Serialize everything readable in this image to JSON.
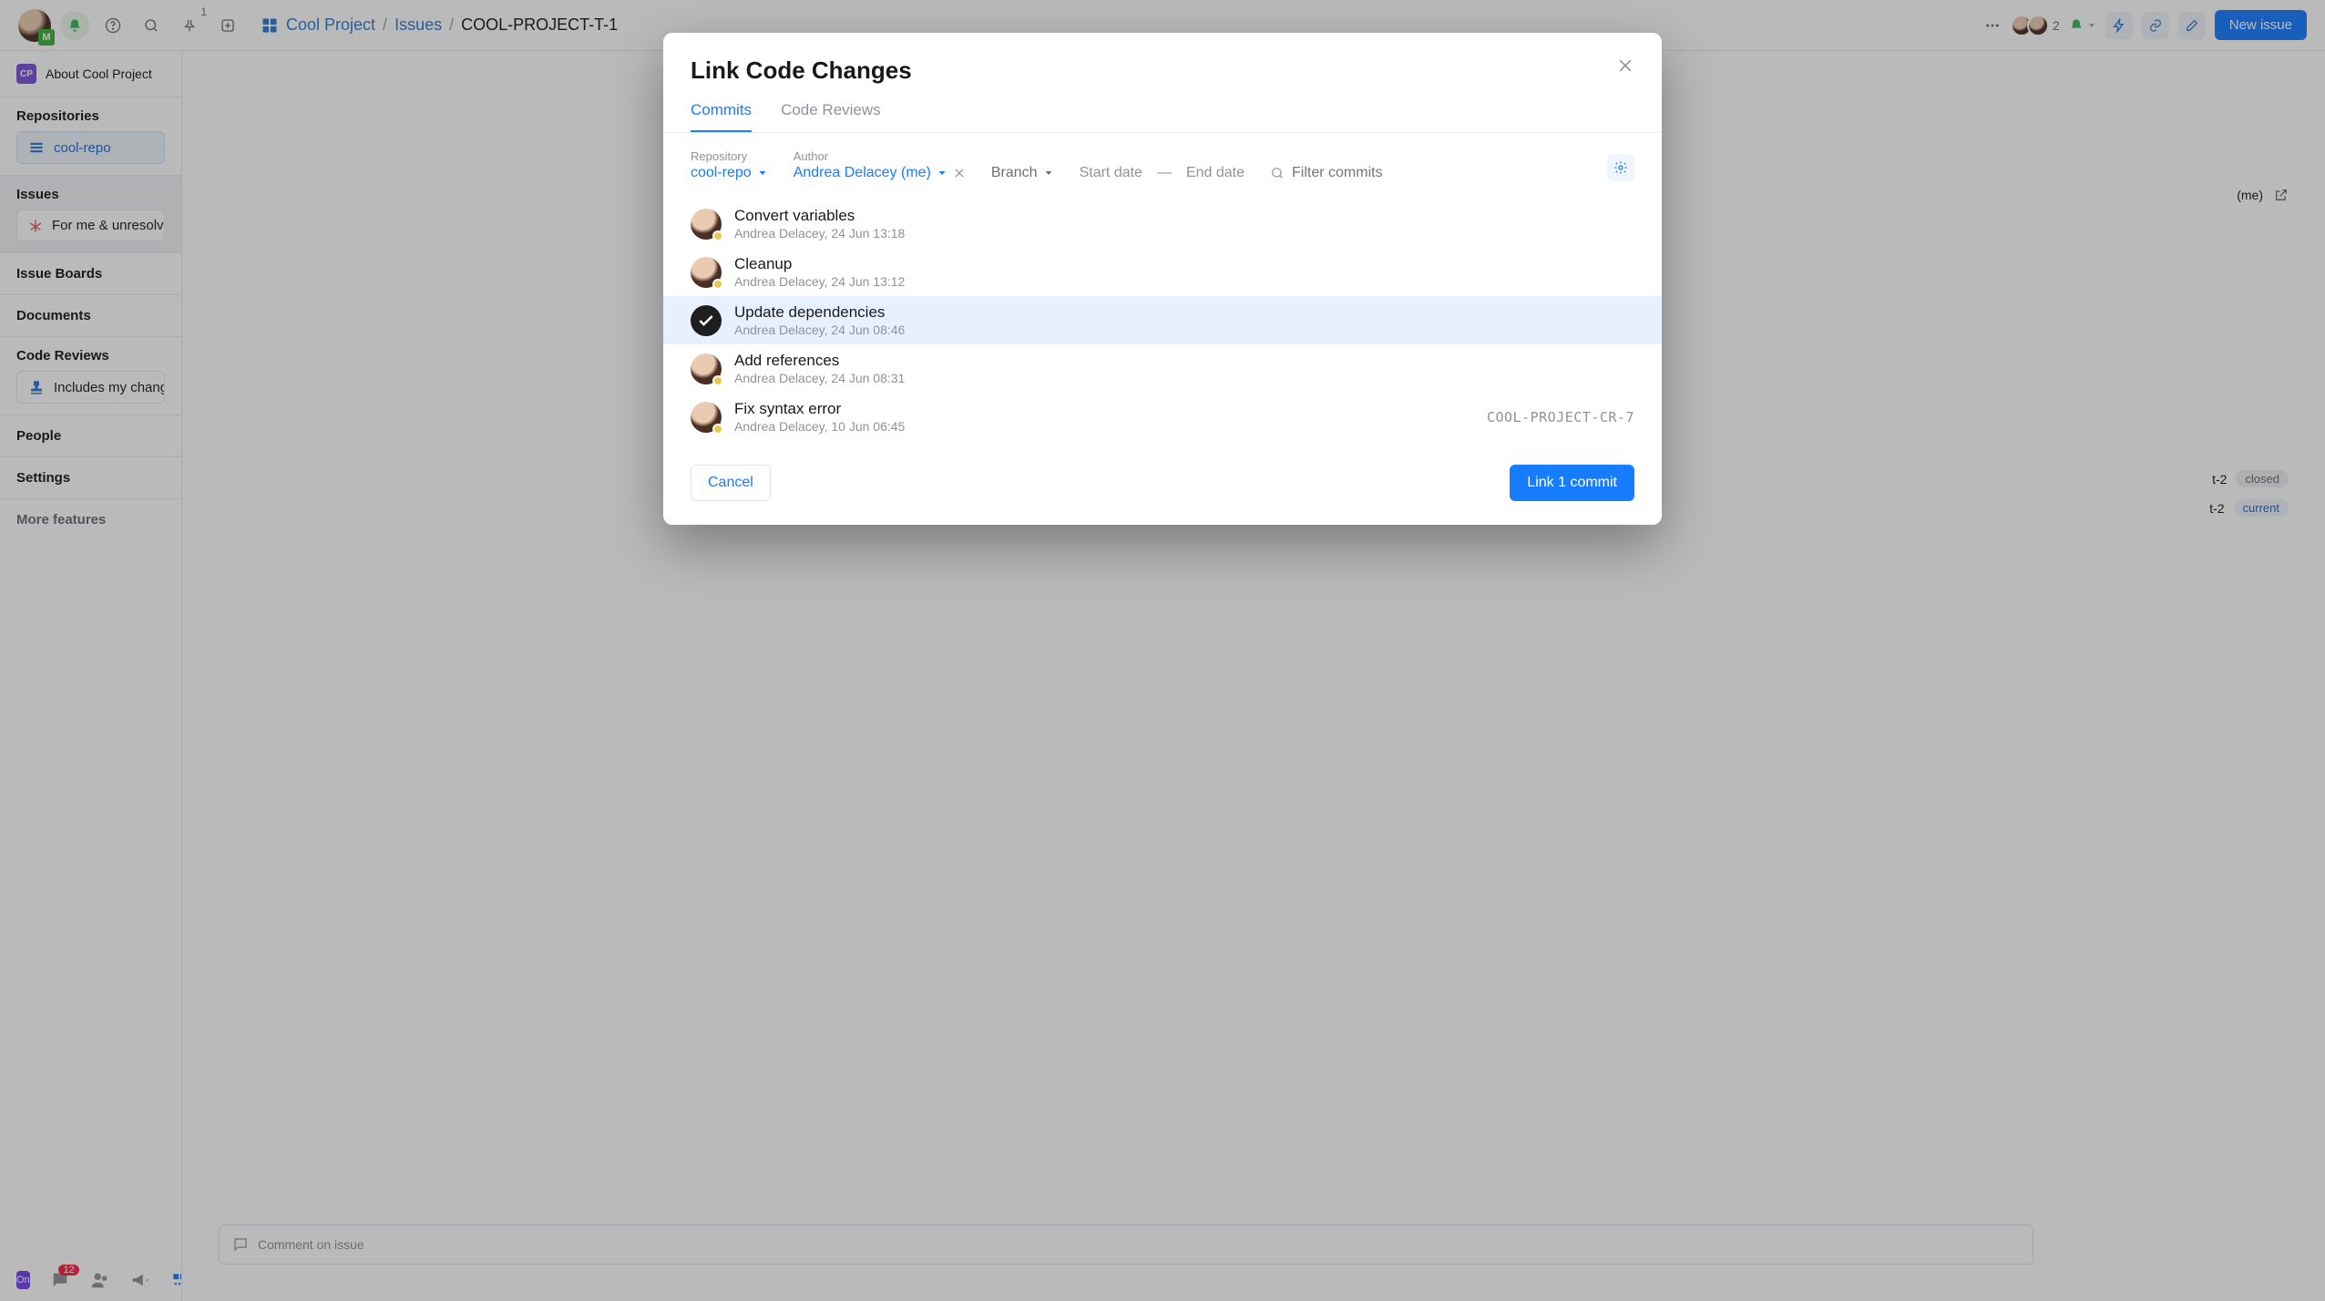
{
  "breadcrumb": {
    "project": "Cool Project",
    "section": "Issues",
    "current": "COOL-PROJECT-T-1"
  },
  "top": {
    "presence_count": "2",
    "notification_sup": "1",
    "new_issue": "New issue"
  },
  "sidebar": {
    "project_badge": "CP",
    "project_name": "About Cool Project",
    "sections": {
      "repositories": "Repositories",
      "repo_item": "cool-repo",
      "issues": "Issues",
      "issues_item": "For me & unresolved",
      "issue_boards": "Issue Boards",
      "documents": "Documents",
      "code_reviews": "Code Reviews",
      "cr_item": "Includes my changes",
      "people": "People",
      "settings": "Settings",
      "more": "More features"
    },
    "bottom": {
      "on": "On",
      "chat_badge": "12"
    }
  },
  "issue_right": {
    "assignee": "(me)",
    "row1": {
      "id": "t-2",
      "state": "closed"
    },
    "row2": {
      "id": "t-2",
      "state": "current"
    }
  },
  "comment_placeholder": "Comment on issue",
  "modal": {
    "title": "Link Code Changes",
    "tabs": {
      "commits": "Commits",
      "code_reviews": "Code Reviews"
    },
    "filters": {
      "repo_label": "Repository",
      "repo_value": "cool-repo",
      "author_label": "Author",
      "author_value": "Andrea Delacey (me)",
      "branch": "Branch",
      "start_date": "Start date",
      "dash": "—",
      "end_date": "End date",
      "filter_placeholder": "Filter commits"
    },
    "commits": [
      {
        "title": "Convert variables",
        "meta": "Andrea Delacey, 24 Jun 13:18",
        "selected": false,
        "tag": ""
      },
      {
        "title": "Cleanup",
        "meta": "Andrea Delacey, 24 Jun 13:12",
        "selected": false,
        "tag": ""
      },
      {
        "title": "Update dependencies",
        "meta": "Andrea Delacey, 24 Jun 08:46",
        "selected": true,
        "tag": ""
      },
      {
        "title": "Add references",
        "meta": "Andrea Delacey, 24 Jun 08:31",
        "selected": false,
        "tag": ""
      },
      {
        "title": "Fix syntax error",
        "meta": "Andrea Delacey, 10 Jun 06:45",
        "selected": false,
        "tag": "COOL-PROJECT-CR-7"
      }
    ],
    "cancel": "Cancel",
    "link_button": "Link 1 commit"
  }
}
